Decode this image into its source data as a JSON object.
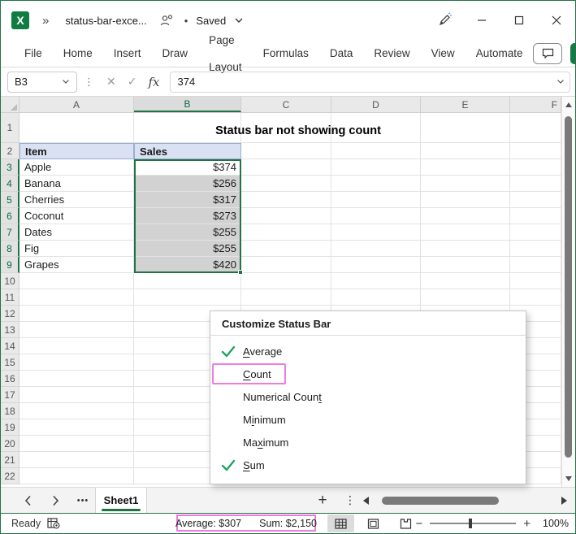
{
  "colors": {
    "accent_green": "#217346",
    "check_green": "#21A366",
    "highlight_pink": "#EE7BE0",
    "table_header_fill": "#D9E1F2",
    "selection_fill": "#D2D2D2"
  },
  "icons": {
    "logo_letter": "X",
    "overflow_chevron": "»",
    "bullet": "•",
    "kebab": "⋮",
    "cancel": "✕",
    "enter_check": "✓",
    "fx": "fx",
    "more_sheets": "•••",
    "add_sheet": "+",
    "zoom_out": "−",
    "zoom_in": "+"
  },
  "title_bar": {
    "document_title": "status-bar-exce...",
    "save_status": "Saved"
  },
  "ribbon": {
    "tabs": [
      "File",
      "Home",
      "Insert",
      "Draw",
      "Page Layout",
      "Formulas",
      "Data",
      "Review",
      "View",
      "Automate"
    ]
  },
  "formula_bar": {
    "cell_reference": "B3",
    "formula_value": "374"
  },
  "grid": {
    "columns": [
      "A",
      "B",
      "C",
      "D",
      "E",
      "F"
    ],
    "selected_column": "B",
    "row_count": 22,
    "selected_row_start": 3,
    "selected_row_end": 9,
    "selection_range": "B3:B9",
    "active_cell": "B3",
    "title_cell": {
      "row": 1,
      "text": "Status bar not showing count"
    },
    "header_cells": {
      "row": 2,
      "item": "Item",
      "sales": "Sales"
    },
    "data_rows": [
      {
        "row": 3,
        "item": "Apple",
        "sales": "$374"
      },
      {
        "row": 4,
        "item": "Banana",
        "sales": "$256"
      },
      {
        "row": 5,
        "item": "Cherries",
        "sales": "$317"
      },
      {
        "row": 6,
        "item": "Coconut",
        "sales": "$273"
      },
      {
        "row": 7,
        "item": "Dates",
        "sales": "$255"
      },
      {
        "row": 8,
        "item": "Fig",
        "sales": "$255"
      },
      {
        "row": 9,
        "item": "Grapes",
        "sales": "$420"
      }
    ]
  },
  "context_menu": {
    "title": "Customize Status Bar",
    "items": [
      {
        "label": "Average",
        "pre": "",
        "key": "A",
        "post": "verage",
        "checked": true,
        "boxed": false
      },
      {
        "label": "Count",
        "pre": "",
        "key": "C",
        "post": "ount",
        "checked": false,
        "boxed": true
      },
      {
        "label": "Numerical Count",
        "pre": "Numerical Coun",
        "key": "t",
        "post": "",
        "checked": false,
        "boxed": false
      },
      {
        "label": "Minimum",
        "pre": "M",
        "key": "i",
        "post": "nimum",
        "checked": false,
        "boxed": false
      },
      {
        "label": "Maximum",
        "pre": "Ma",
        "key": "x",
        "post": "imum",
        "checked": false,
        "boxed": false
      },
      {
        "label": "Sum",
        "pre": "",
        "key": "S",
        "post": "um",
        "checked": true,
        "boxed": false
      }
    ]
  },
  "sheet_bar": {
    "active_sheet": "Sheet1"
  },
  "status_bar": {
    "mode": "Ready",
    "average_label": "Average: $307",
    "sum_label": "Sum: $2,150",
    "zoom_level": "100%"
  }
}
